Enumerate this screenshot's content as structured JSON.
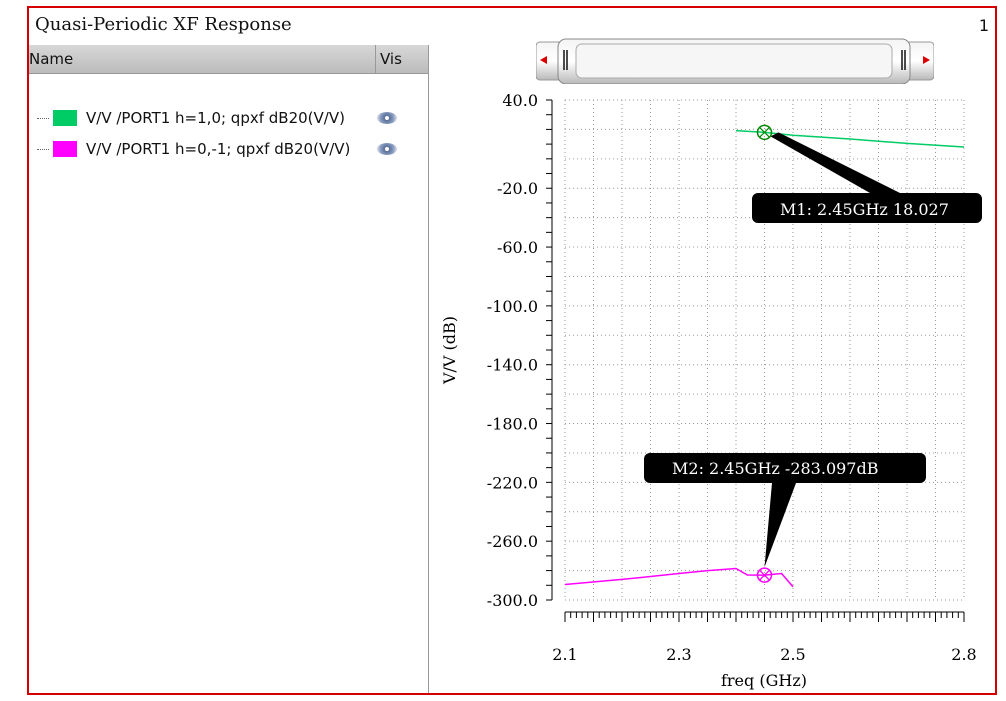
{
  "window": {
    "title": "Quasi-Periodic XF Response",
    "number": "1"
  },
  "legend": {
    "col_name": "Name",
    "col_vis": "Vis",
    "items": [
      {
        "label": "V/V /PORT1 h=1,0; qpxf dB20(V/V)",
        "color": "#00cc66",
        "visible": true
      },
      {
        "label": "V/V /PORT1 h=0,-1; qpxf dB20(V/V)",
        "color": "#ff00ff",
        "visible": true
      }
    ]
  },
  "chart_data": {
    "type": "line",
    "xlabel": "freq (GHz)",
    "ylabel": "V/V (dB)",
    "xlim": [
      2.1,
      2.8
    ],
    "ylim": [
      -300,
      40
    ],
    "xticks": [
      "2.1",
      "2.3",
      "2.5",
      "2.8"
    ],
    "yticks": [
      "40.0",
      "-20.0",
      "-60.0",
      "-100.0",
      "-140.0",
      "-180.0",
      "-220.0",
      "-260.0",
      "-300.0"
    ],
    "ytick_values": [
      40,
      -20,
      -60,
      -100,
      -140,
      -180,
      -220,
      -260,
      -300
    ],
    "xtick_values": [
      2.1,
      2.3,
      2.5,
      2.8
    ],
    "grid": true,
    "series": [
      {
        "name": "V/V /PORT1 h=1,0; qpxf dB20(V/V)",
        "color": "#00cc66",
        "x": [
          2.4,
          2.45,
          2.5,
          2.6,
          2.7,
          2.8
        ],
        "y": [
          19.2,
          18.02,
          16,
          13.5,
          10.5,
          8
        ]
      },
      {
        "name": "V/V /PORT1 h=0,-1; qpxf dB20(V/V)",
        "color": "#ff00ff",
        "x": [
          2.1,
          2.2,
          2.3,
          2.35,
          2.4,
          2.42,
          2.45,
          2.48,
          2.5
        ],
        "y": [
          -289.5,
          -286,
          -282,
          -280,
          -278.6,
          -283,
          -283.1,
          -282,
          -291
        ]
      }
    ],
    "markers": [
      {
        "label": "M1: 2.45GHz 18.027",
        "x": 2.45,
        "y": 18.02,
        "color": "#008800"
      },
      {
        "label": "M2: 2.45GHz -283.097dB",
        "x": 2.45,
        "y": -283.097,
        "color": "#ff00ff"
      }
    ]
  }
}
